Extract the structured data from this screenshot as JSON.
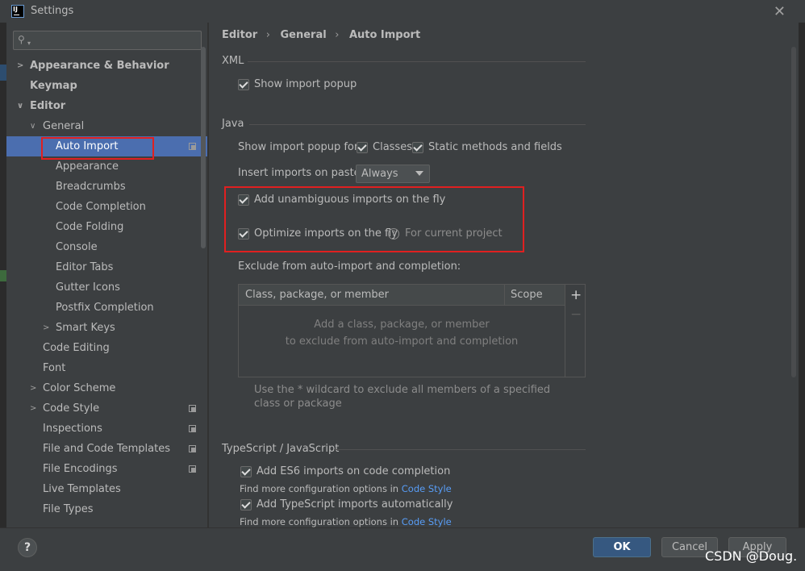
{
  "window": {
    "title": "Settings"
  },
  "search": {
    "placeholder": ""
  },
  "tree": {
    "items": [
      {
        "label": "Appearance & Behavior"
      },
      {
        "label": "Keymap"
      },
      {
        "label": "Editor"
      },
      {
        "label": "General"
      },
      {
        "label": "Auto Import"
      },
      {
        "label": "Appearance"
      },
      {
        "label": "Breadcrumbs"
      },
      {
        "label": "Code Completion"
      },
      {
        "label": "Code Folding"
      },
      {
        "label": "Console"
      },
      {
        "label": "Editor Tabs"
      },
      {
        "label": "Gutter Icons"
      },
      {
        "label": "Postfix Completion"
      },
      {
        "label": "Smart Keys"
      },
      {
        "label": "Code Editing"
      },
      {
        "label": "Font"
      },
      {
        "label": "Color Scheme"
      },
      {
        "label": "Code Style"
      },
      {
        "label": "Inspections"
      },
      {
        "label": "File and Code Templates"
      },
      {
        "label": "File Encodings"
      },
      {
        "label": "Live Templates"
      },
      {
        "label": "File Types"
      }
    ]
  },
  "breadcrumb": {
    "part1": "Editor",
    "part2": "General",
    "part3": "Auto Import",
    "separator": "›"
  },
  "xml": {
    "title": "XML",
    "show_import_popup": "Show import popup"
  },
  "java": {
    "title": "Java",
    "show_popup_for": "Show import popup for:",
    "classes": "Classes",
    "static_methods": "Static methods and fields",
    "insert_on_paste": "Insert imports on paste:",
    "insert_on_paste_value": "Always",
    "add_unambiguous": "Add unambiguous imports on the fly",
    "optimize_imports": "Optimize imports on the fly",
    "for_current_project": "For current project",
    "exclude_label": "Exclude from auto-import and completion:",
    "table": {
      "col_class": "Class, package, or member",
      "col_scope": "Scope",
      "empty_line1": "Add a class, package, or member",
      "empty_line2": "to exclude from auto-import and completion"
    },
    "wildcard_hint": "Use the * wildcard to exclude all members of a specified class or package"
  },
  "typescript": {
    "title": "TypeScript / JavaScript",
    "add_es6": "Add ES6 imports on code completion",
    "find_more_1": "Find more configuration options in",
    "code_style_link_1": "Code Style",
    "add_ts_auto": "Add TypeScript imports automatically",
    "find_more_2": "Find more configuration options in",
    "code_style_link_2": "Code Style"
  },
  "footer": {
    "help": "?",
    "ok": "OK",
    "cancel": "Cancel",
    "apply": "Apply"
  },
  "watermark": "CSDN @Doug.",
  "colors": {
    "selection": "#4b6eaf",
    "highlight_box": "#e02020",
    "link": "#589df6",
    "ok_button": "#365880"
  },
  "icons": {
    "close": "close-icon",
    "search": "search-icon",
    "copy": "project-settings-icon",
    "add": "add-icon",
    "remove": "remove-icon",
    "help": "help-icon"
  }
}
